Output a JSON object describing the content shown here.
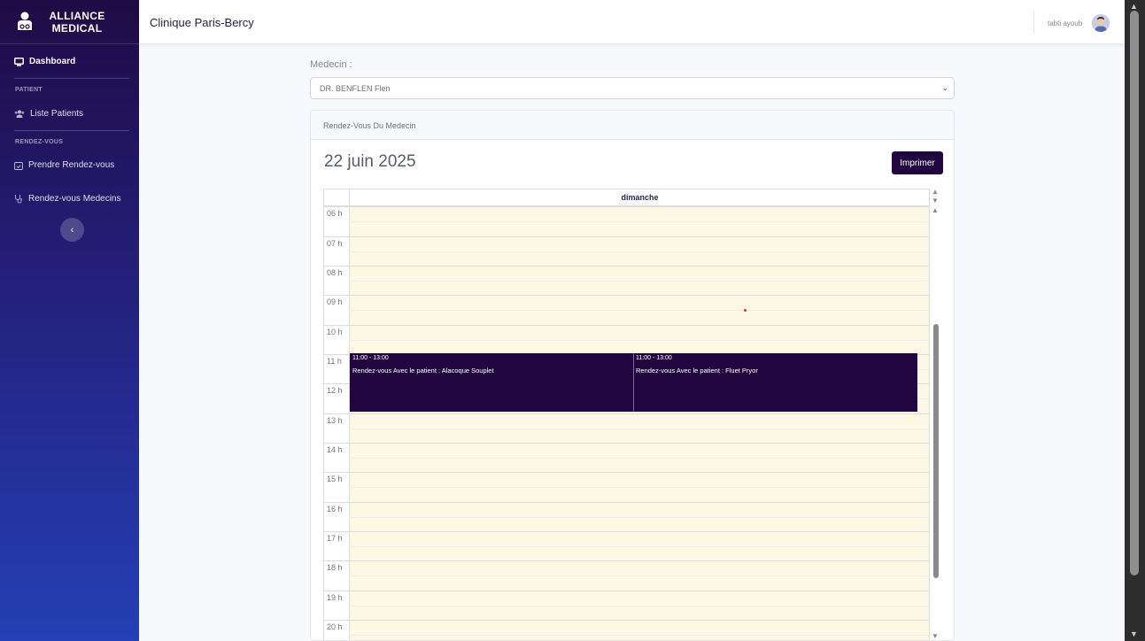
{
  "brand": {
    "line1": "ALLIANCE",
    "line2": "MEDICAL"
  },
  "sidebar": {
    "dashboard": "Dashboard",
    "section_patient": "PATIENT",
    "liste_patients": "Liste Patients",
    "section_rdv": "RENDEZ-VOUS",
    "prendre_rdv": "Prendre Rendez-vous",
    "rdv_medecins": "Rendez-vous Medecins",
    "toggle": "‹"
  },
  "topbar": {
    "clinic": "Clinique Paris-Bercy",
    "user": "tabti ayoub"
  },
  "form": {
    "medecin_label": "Medecin :",
    "medecin_value": "DR. BENFLEN Flen",
    "chevron": "⌄"
  },
  "card": {
    "title": "Rendez-Vous Du Medecin",
    "date": "22 juin 2025",
    "print": "Imprimer"
  },
  "calendar": {
    "day": "dimanche",
    "hours": [
      "06 h",
      "07 h",
      "08 h",
      "09 h",
      "10 h",
      "11 h",
      "12 h",
      "13 h",
      "14 h",
      "15 h",
      "16 h",
      "17 h",
      "18 h",
      "19 h",
      "20 h"
    ],
    "events": [
      {
        "time": "11:00 - 13:00",
        "desc": "Rendez-vous Avec le patient : Alacoque Souplet"
      },
      {
        "time": "11:00 - 13:00",
        "desc": "Rendez-vous Avec le patient : Fluet Pryor"
      }
    ]
  },
  "colors": {
    "primary": "#22063f",
    "day_bg": "#fcf8e3",
    "now_indicator": "#e02d2d"
  }
}
